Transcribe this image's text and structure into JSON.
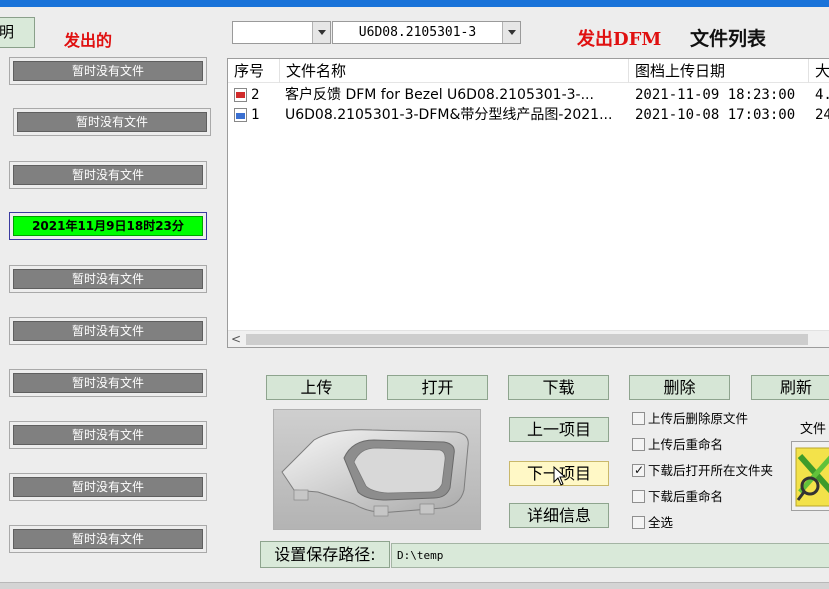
{
  "header": {
    "left_button_label": "明",
    "sent_label": "发出的",
    "sent_dfm_label": "发出DFM",
    "file_list_title": "文件列表"
  },
  "selectors": {
    "combo1_value": "",
    "combo2_value": "U6D08.2105301-3"
  },
  "status_buttons": [
    {
      "label": "暂时没有文件",
      "active": false
    },
    {
      "label": "暂时没有文件",
      "active": false
    },
    {
      "label": "暂时没有文件",
      "active": false
    },
    {
      "label": "2021年11月9日18时23分",
      "active": true
    },
    {
      "label": "暂时没有文件",
      "active": false
    },
    {
      "label": "暂时没有文件",
      "active": false
    },
    {
      "label": "暂时没有文件",
      "active": false
    },
    {
      "label": "暂时没有文件",
      "active": false
    },
    {
      "label": "暂时没有文件",
      "active": false
    },
    {
      "label": "暂时没有文件",
      "active": false
    }
  ],
  "file_list": {
    "columns": [
      "序号",
      "文件名称",
      "图档上传日期",
      "大"
    ],
    "rows": [
      {
        "index": "2",
        "name": "客户反馈 DFM for Bezel U6D08.2105301-3-...",
        "date": "2021-11-09 18:23:00",
        "size": "4.",
        "icon": "pdf-file-icon"
      },
      {
        "index": "1",
        "name": "U6D08.2105301-3-DFM&带分型线产品图-2021...",
        "date": "2021-10-08 17:03:00",
        "size": "24",
        "icon": "image-file-icon"
      }
    ]
  },
  "actions": {
    "upload": "上传",
    "open": "打开",
    "download": "下载",
    "delete": "删除",
    "refresh": "刷新",
    "prev_item": "上一项目",
    "next_item": "下一项目",
    "details": "详细信息"
  },
  "options": [
    {
      "label": "上传后删除原文件",
      "checked": false
    },
    {
      "label": "上传后重命名",
      "checked": false
    },
    {
      "label": "下载后打开所在文件夹",
      "checked": true
    },
    {
      "label": "下载后重命名",
      "checked": false
    },
    {
      "label": "全选",
      "checked": false
    }
  ],
  "save_path": {
    "label": "设置保存路径:",
    "value": "D:\\temp"
  },
  "side": {
    "label": "文件"
  },
  "colors": {
    "accent_bar": "#1a73d9",
    "active_status": "#00ff00",
    "button_green": "#d6e6d6",
    "highlight_button": "#fff8c6",
    "title_red": "#e01010"
  }
}
